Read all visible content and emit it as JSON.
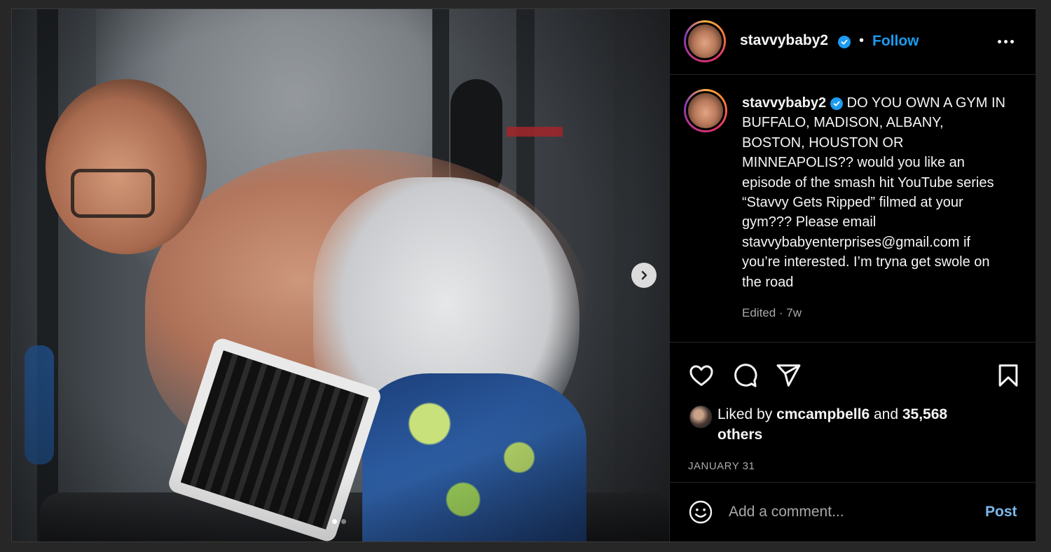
{
  "post": {
    "author": "stavvybaby2",
    "follow_label": "Follow",
    "separator": "•",
    "caption": "DO YOU OWN A GYM IN BUFFALO, MADISON, ALBANY, BOSTON, HOUSTON OR MINNEAPOLIS?? would you like an episode of the smash hit YouTube series “Stavvy Gets Ripped” filmed at your gym??? Please email stavvybabyenterprises@gmail.com if you’re interested. I’m tryna get swole on the road",
    "meta": "Edited · 7w",
    "media": {
      "carousel_count": 2,
      "carousel_active": 0
    }
  },
  "likes": {
    "prefix": "Liked by ",
    "user": "cmcampbell6",
    "and": " and ",
    "count": "35,568",
    "suffix": "others"
  },
  "date": "JANUARY 31",
  "comment": {
    "placeholder": "Add a comment...",
    "post_label": "Post"
  },
  "icons": {
    "like": "heart-icon",
    "comment": "comment-icon",
    "share": "share-icon",
    "save": "bookmark-icon",
    "emoji": "emoji-icon",
    "more": "more-icon",
    "next": "chevron-right-icon",
    "verified": "verified-badge-icon"
  },
  "colors": {
    "background": "#000000",
    "accent": "#1a9bf0",
    "muted": "#a8a8a8",
    "text": "#f5f5f5",
    "post_button": "#7ab8ec"
  }
}
